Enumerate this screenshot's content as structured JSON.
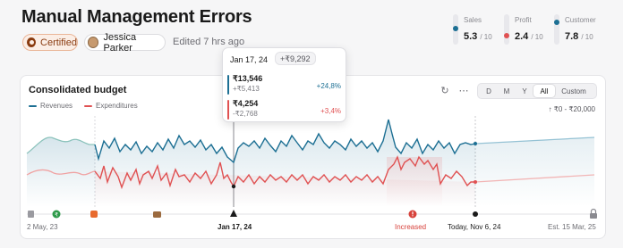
{
  "page": {
    "title": "Manual Management Errors"
  },
  "meta": {
    "certified_label": "Certified",
    "user_name": "Jessica Parker",
    "edited": "Edited 7 hrs ago"
  },
  "metrics": [
    {
      "name": "Sales",
      "value": "5.3",
      "scale": "/ 10",
      "color": "#1c6f93",
      "fraction": 0.53
    },
    {
      "name": "Profit",
      "value": "2.4",
      "scale": "/ 10",
      "color": "#e05152",
      "fraction": 0.24
    },
    {
      "name": "Customer",
      "value": "7.8",
      "scale": "/ 10",
      "color": "#1c6f93",
      "fraction": 0.78
    }
  ],
  "card": {
    "title": "Consolidated budget",
    "legend": [
      {
        "label": "Revenues",
        "color": "#1c6f93"
      },
      {
        "label": "Expenditures",
        "color": "#e05152"
      }
    ],
    "range_options": [
      "D",
      "M",
      "Y",
      "All",
      "Custom"
    ],
    "range_selected": "All",
    "range_label": "↑ ₹0 - ₹20,000"
  },
  "tooltip": {
    "date": "Jan 17, 24",
    "total": "+₹9,292",
    "revenue": {
      "amount": "₹13,546",
      "diff": "+₹5,413",
      "pct": "+24,8%"
    },
    "expenditure": {
      "amount": "₹4,254",
      "diff": "-₹2,768",
      "pct": "+3,4%"
    }
  },
  "timeline": {
    "start": "2 May, 23",
    "cursor": "Jan 17, 24",
    "alert": "Increased",
    "today": "Today, Nov 6, 24",
    "estimate": "Est. 15 Mar, 25"
  },
  "colors": {
    "revenue": "#1c6f93",
    "expenditure": "#e05152",
    "alert": "#d7423b"
  },
  "icons": [
    "medal-icon",
    "refresh-icon",
    "more-icon",
    "document-icon",
    "rupee-icon",
    "flag-icon",
    "briefcase-icon",
    "cursor-marker-icon",
    "alert-icon",
    "today-marker-icon",
    "lock-icon"
  ]
}
